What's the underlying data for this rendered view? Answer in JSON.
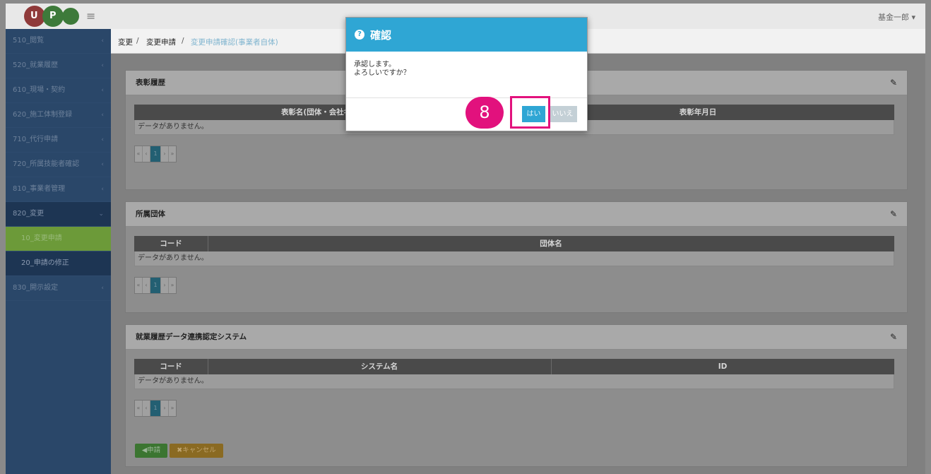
{
  "topbar": {
    "logo_u": "U",
    "logo_p": "P",
    "menu_icon": "≡",
    "user": "基金一郎 ▾"
  },
  "sidebar": {
    "items": [
      {
        "label": "510_閲覧"
      },
      {
        "label": "520_就業履歴"
      },
      {
        "label": "610_現場・契約"
      },
      {
        "label": "620_施工体制登録"
      },
      {
        "label": "710_代行申請"
      },
      {
        "label": "720_所属技能者確認"
      },
      {
        "label": "810_事業者管理"
      },
      {
        "label": "820_変更"
      },
      {
        "label": "10_変更申請"
      },
      {
        "label": "20_申請の修正"
      },
      {
        "label": "830_開示設定"
      }
    ]
  },
  "breadcrumb": {
    "a": "変更",
    "sep": "/",
    "b": "変更申請",
    "c": "変更申請確認(事業者自体)"
  },
  "cards": {
    "award": {
      "title": "表彰履歴",
      "col1": "表彰名(団体・会社名)",
      "col2": "表彰年月日",
      "empty": "データがありません。"
    },
    "group": {
      "title": "所属団体",
      "col1": "コード",
      "col2": "団体名",
      "empty": "データがありません。"
    },
    "system": {
      "title": "就業履歴データ連携認定システム",
      "col1": "コード",
      "col2": "システム名",
      "col3": "ID",
      "empty": "データがありません。"
    }
  },
  "pager": {
    "first": "«",
    "prev": "‹",
    "page": "1",
    "next": "›",
    "last": "»"
  },
  "actions": {
    "apply": "◀申請",
    "cancel": "✖キャンセル"
  },
  "modal": {
    "title": "確認",
    "line1": "承認します。",
    "line2": "よろしいですか？",
    "yes": "はい",
    "no": "いいえ"
  },
  "annotation": {
    "step": "8"
  },
  "colors": {
    "accent": "#2fa6d4",
    "highlight": "#e2117d",
    "sidebar": "#2a4769"
  }
}
